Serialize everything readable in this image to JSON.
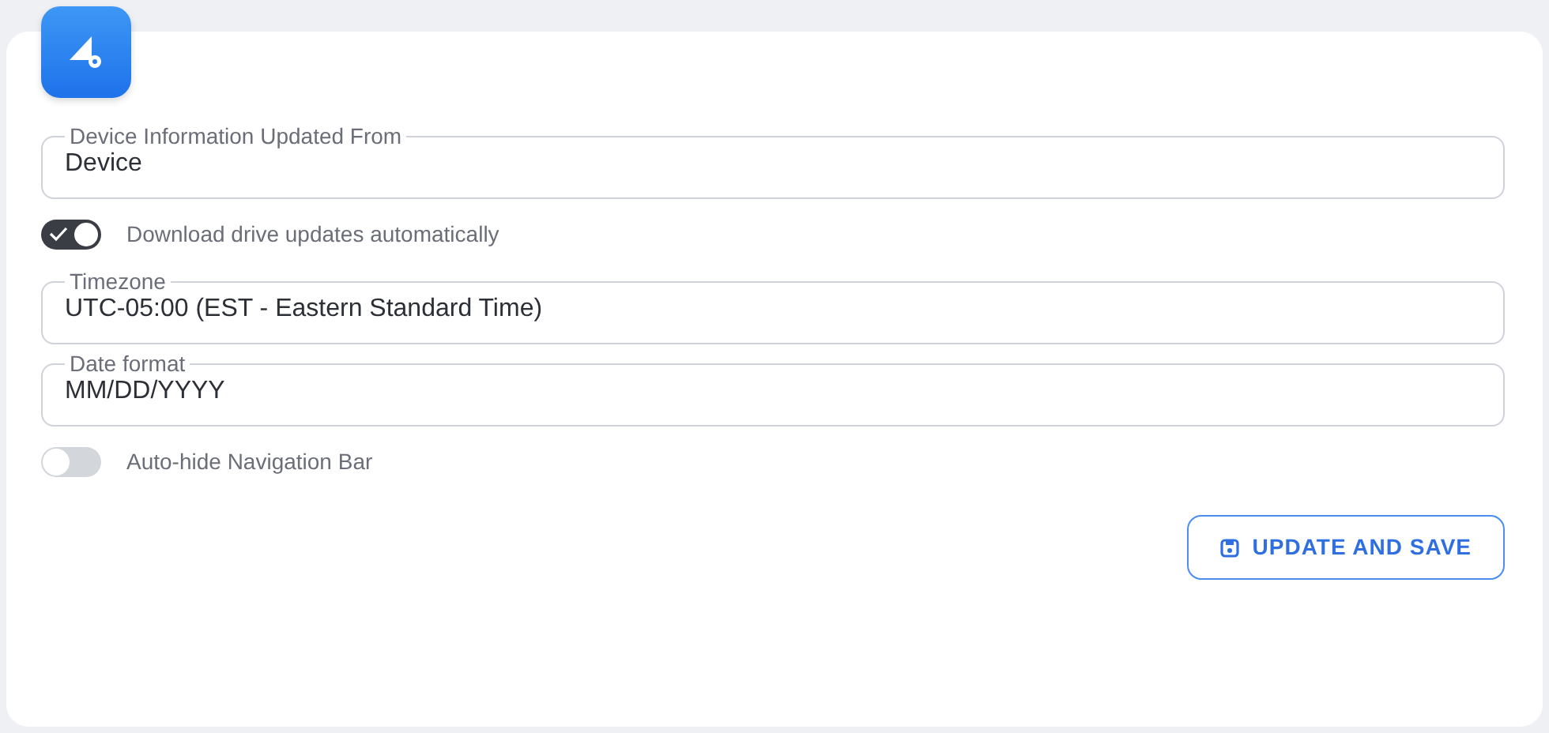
{
  "settings": [
    {
      "kind": "field",
      "label": "Device Information Updated From",
      "value": "Device"
    },
    {
      "kind": "toggle",
      "label": "Download drive updates automatically",
      "on": true
    },
    {
      "kind": "field",
      "label": "Timezone",
      "value": "UTC-05:00 (EST - Eastern Standard Time)"
    },
    {
      "kind": "field",
      "label": "Date format",
      "value": "MM/DD/YYYY"
    },
    {
      "kind": "toggle",
      "label": "Auto-hide Navigation Bar",
      "on": false
    }
  ],
  "button": {
    "label": "UPDATE AND SAVE"
  }
}
